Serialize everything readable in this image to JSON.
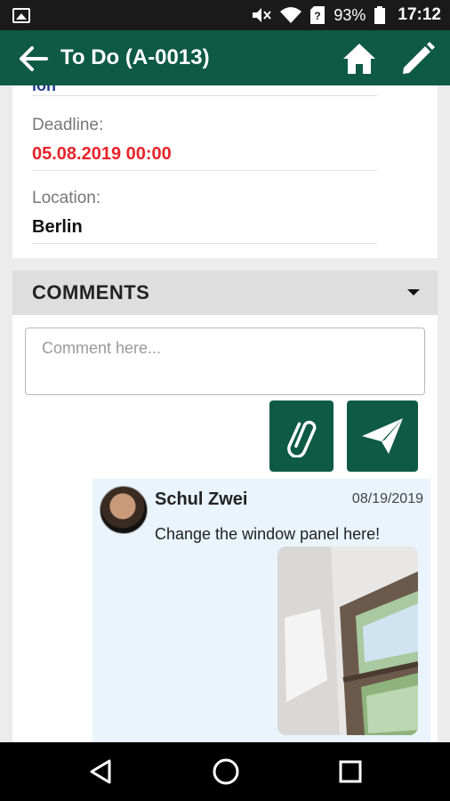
{
  "status_bar": {
    "battery": "93%",
    "time": "17:12"
  },
  "app_bar": {
    "title": "To Do (A-0013)"
  },
  "details": {
    "clipped_value": "ion",
    "deadline_label": "Deadline:",
    "deadline_value": "05.08.2019 00:00",
    "location_label": "Location:",
    "location_value": "Berlin"
  },
  "comments": {
    "header": "COMMENTS",
    "placeholder": "Comment here...",
    "items": [
      {
        "author": "Schul Zwei",
        "date": "08/19/2019",
        "text": "Change the window panel here!"
      }
    ]
  },
  "colors": {
    "primary": "#0e5a44",
    "deadline": "#e8232a",
    "comment_bg": "#e9f4fd"
  }
}
